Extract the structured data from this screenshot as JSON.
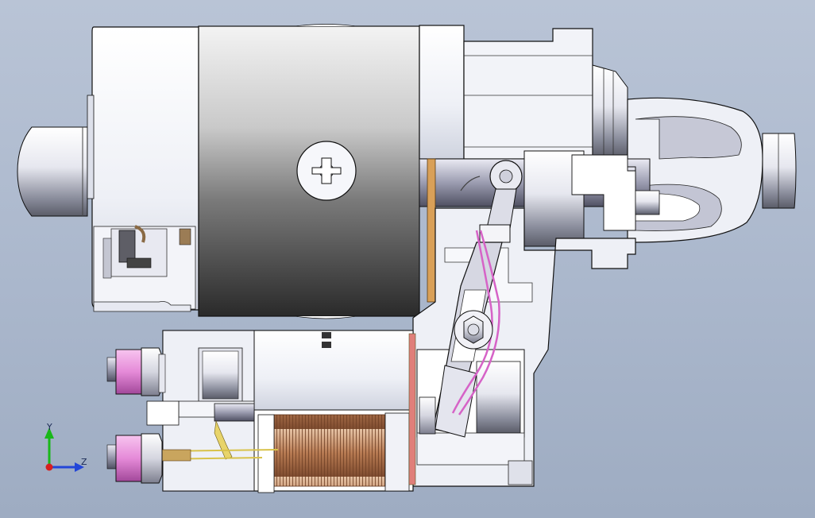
{
  "view": {
    "background_top": "#b9c4d6",
    "background_bottom": "#9eacc2"
  },
  "triad": {
    "y_label": "Y",
    "z_label": "Z",
    "y_color": "#19b819",
    "z_color": "#2346d8",
    "x_color": "#d81f1f"
  },
  "part": {
    "housing_color": "#f4f6fa",
    "motor_shell_color": "#3e3e3e",
    "coil_color": "#b77a52",
    "spring_color": "#d663c7",
    "nut_color": "#e58ad8"
  }
}
